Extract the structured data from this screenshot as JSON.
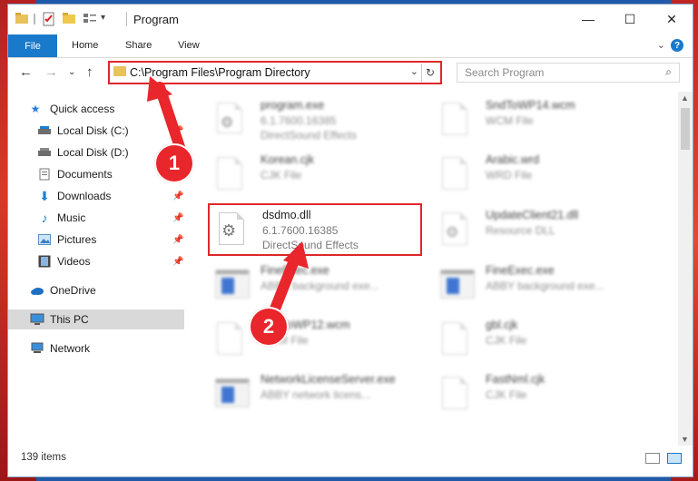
{
  "window": {
    "title": "Program",
    "minimize": "—",
    "maximize": "☐",
    "close": "✕"
  },
  "ribbon": {
    "tabs": [
      "File",
      "Home",
      "Share",
      "View"
    ],
    "expand": "⌄",
    "help": "?"
  },
  "address": {
    "path": "C:\\Program Files\\Program Directory",
    "dropdown": "⌄",
    "refresh": "↻"
  },
  "search": {
    "placeholder": "Search Program",
    "icon": "⌕"
  },
  "nav_buttons": {
    "back": "←",
    "forward": "→",
    "recent": "⌄",
    "up": "↑"
  },
  "nav": {
    "items": [
      {
        "label": "Quick access",
        "icon": "star-icon"
      },
      {
        "label": "Local Disk (C:)",
        "icon": "drive-icon",
        "pinned": true
      },
      {
        "label": "Local Disk (D:)",
        "icon": "drive-icon",
        "pinned": true
      },
      {
        "label": "Documents",
        "icon": "documents-icon",
        "pinned": true
      },
      {
        "label": "Downloads",
        "icon": "downloads-icon",
        "pinned": true
      },
      {
        "label": "Music",
        "icon": "music-icon",
        "pinned": true
      },
      {
        "label": "Pictures",
        "icon": "pictures-icon",
        "pinned": true
      },
      {
        "label": "Videos",
        "icon": "videos-icon",
        "pinned": true
      },
      {
        "label": "OneDrive",
        "icon": "cloud-icon"
      },
      {
        "label": "This PC",
        "icon": "computer-icon",
        "selected": true
      },
      {
        "label": "Network",
        "icon": "network-icon"
      }
    ],
    "pin_glyph": "📌"
  },
  "files": [
    {
      "name": "program.exe",
      "line2": "6.1.7600.16385",
      "line3": "DirectSound Effects",
      "icon": "gear-file-icon",
      "blurred": true
    },
    {
      "name": "SndToWP14.wcm",
      "line2": "WCM File",
      "line3": "",
      "icon": "blank-file-icon",
      "blurred": true
    },
    {
      "name": "Korean.cjk",
      "line2": "CJK File",
      "line3": "",
      "icon": "blank-file-icon",
      "blurred": true
    },
    {
      "name": "Arabic.wrd",
      "line2": "WRD File",
      "line3": "",
      "icon": "blank-file-icon",
      "blurred": true
    },
    {
      "name": "dsdmo.dll",
      "line2": "6.1.7600.16385",
      "line3": "DirectSound Effects",
      "icon": "gear-file-icon",
      "blurred": false
    },
    {
      "name": "UpdateClient21.dll",
      "line2": "Resource DLL",
      "line3": "",
      "icon": "gear-file-icon",
      "blurred": true
    },
    {
      "name": "FineExec.exe",
      "line2": "ABBY background exe...",
      "line3": "",
      "icon": "app-icon",
      "blurred": true
    },
    {
      "name": "FineExec.exe",
      "line2": "ABBY background exe...",
      "line3": "",
      "icon": "app-icon",
      "blurred": true
    },
    {
      "name": "SndToWP12.wcm",
      "line2": "WCM File",
      "line3": "",
      "icon": "blank-file-icon",
      "blurred": true
    },
    {
      "name": "gbl.cjk",
      "line2": "CJK File",
      "line3": "",
      "icon": "blank-file-icon",
      "blurred": true
    },
    {
      "name": "NetworkLicenseServer.exe",
      "line2": "ABBY network licens...",
      "line3": "",
      "icon": "app-icon",
      "blurred": true
    },
    {
      "name": "FastNml.cjk",
      "line2": "CJK File",
      "line3": "",
      "icon": "blank-file-icon",
      "blurred": true
    }
  ],
  "status": {
    "count": "139 items"
  },
  "annotations": {
    "badge1": "1",
    "badge2": "2",
    "accent": "#e0262c"
  }
}
